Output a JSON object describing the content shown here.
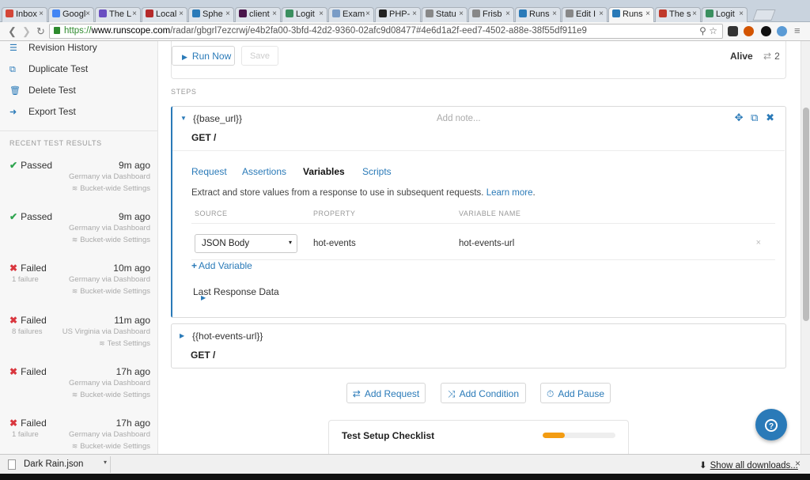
{
  "browser": {
    "tabs": [
      {
        "title": "Inbox",
        "color": "#d44638"
      },
      {
        "title": "Google",
        "color": "#4285f4"
      },
      {
        "title": "The L",
        "color": "#6a4fc1"
      },
      {
        "title": "Local",
        "color": "#b52a2a"
      },
      {
        "title": "Sphe",
        "color": "#2a7ab8"
      },
      {
        "title": "client",
        "color": "#4a154b"
      },
      {
        "title": "Logit",
        "color": "#3a8f5f"
      },
      {
        "title": "Exam",
        "color": "#7a9cc6"
      },
      {
        "title": "PHP-",
        "color": "#222222"
      },
      {
        "title": "Statu",
        "color": "#888888"
      },
      {
        "title": "Frisb",
        "color": "#888888"
      },
      {
        "title": "Runs",
        "color": "#2a7ab8"
      },
      {
        "title": "Edit I",
        "color": "#888888"
      },
      {
        "title": "Runs",
        "color": "#2a7ab8"
      },
      {
        "title": "The s",
        "color": "#c0392b"
      },
      {
        "title": "Logit",
        "color": "#3a8f5f"
      }
    ],
    "tab_close": "×",
    "url_scheme": "https://",
    "url_host": "www.runscope.com",
    "url_path": "/radar/gbgrl7ezcrwj/e4b2fa00-3bfd-42d2-9360-02afc9d08477#4e6d1a2f-eed7-4502-a88e-38f55df911e9",
    "nav_back": "❮",
    "nav_forward": "❯",
    "nav_reload": "↻",
    "omni_search_icon": "⚲",
    "omni_star_icon": "☆",
    "menu_icon": "≡"
  },
  "sidebar": {
    "actions": [
      {
        "label": "Revision History",
        "icon": "list-icon",
        "glyph": "☰"
      },
      {
        "label": "Duplicate Test",
        "icon": "copy-icon",
        "glyph": "⧉"
      },
      {
        "label": "Delete Test",
        "icon": "trash-icon",
        "glyph": "🗑"
      },
      {
        "label": "Export Test",
        "icon": "export-icon",
        "glyph": "➜"
      }
    ],
    "results_heading": "RECENT TEST RESULTS",
    "results": [
      {
        "status": "Passed",
        "mark": "✔",
        "time": "9m ago",
        "failures": "",
        "location": "Germany via Dashboard",
        "settings": "Bucket-wide Settings"
      },
      {
        "status": "Passed",
        "mark": "✔",
        "time": "9m ago",
        "failures": "",
        "location": "Germany via Dashboard",
        "settings": "Bucket-wide Settings"
      },
      {
        "status": "Failed",
        "mark": "✖",
        "time": "10m ago",
        "failures": "1 failure",
        "location": "Germany via Dashboard",
        "settings": "Bucket-wide Settings"
      },
      {
        "status": "Failed",
        "mark": "✖",
        "time": "11m ago",
        "failures": "8 failures",
        "location": "US Virginia via Dashboard",
        "settings": "Test Settings"
      },
      {
        "status": "Failed",
        "mark": "✖",
        "time": "17h ago",
        "failures": "",
        "location": "Germany via Dashboard",
        "settings": "Bucket-wide Settings"
      },
      {
        "status": "Failed",
        "mark": "✖",
        "time": "17h ago",
        "failures": "1 failure",
        "location": "Germany via Dashboard",
        "settings": "Bucket-wide Settings"
      }
    ],
    "settings_glyph": "≋"
  },
  "toolbar": {
    "run_icon": "▶",
    "run_label": "Run Now",
    "save_label": "Save",
    "alive_label": "Alive",
    "share_icon": "⇄",
    "share_count": "2"
  },
  "steps_label": "STEPS",
  "step1": {
    "chevron": "▼",
    "url": "{{base_url}}",
    "note_placeholder": "Add note...",
    "move_icon": "✥",
    "duplicate_icon": "⧉",
    "delete_icon": "✖",
    "method_path": "GET /",
    "tabs": [
      "Request",
      "Assertions",
      "Variables",
      "Scripts"
    ],
    "active_tab": "Variables",
    "description": "Extract and store values from a response to use in subsequent requests.",
    "learn_more": "Learn more",
    "description_end": ".",
    "columns": [
      "SOURCE",
      "PROPERTY",
      "VARIABLE NAME"
    ],
    "variable": {
      "source": "JSON Body",
      "property": "hot-events",
      "name": "hot-events-url"
    },
    "select_caret": "▾",
    "remove_icon": "×",
    "add_variable_plus": "+",
    "add_variable": "Add Variable",
    "last_response_chevron": "▶",
    "last_response": "Last Response Data"
  },
  "step2": {
    "chevron": "▶",
    "url": "{{hot-events-url}}",
    "method_path": "GET /"
  },
  "actions": {
    "add_request_icon": "⇄",
    "add_request": "Add Request",
    "add_condition_icon": "⤨",
    "add_condition": "Add Condition",
    "add_pause_icon": "⏱",
    "add_pause": "Add Pause"
  },
  "checklist": {
    "title": "Test Setup Checklist",
    "progress": 0.3,
    "progress_color": "#f39c12"
  },
  "help_icon": "?",
  "downloads": {
    "file_name": "Dark Rain.json",
    "dropdown_icon": "▾",
    "show_all_icon": "⬇",
    "show_all": "Show all downloads...",
    "close_icon": "×"
  },
  "colors": {
    "accent": "#2a7ab8",
    "passed": "#2ea44f",
    "failed": "#d9363e"
  }
}
